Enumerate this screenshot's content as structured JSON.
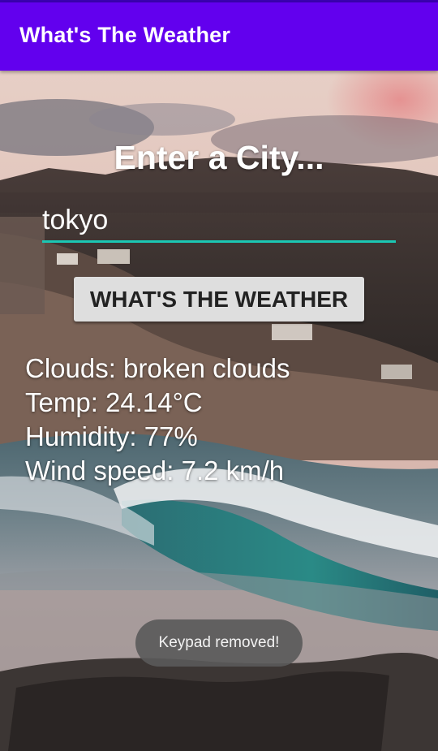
{
  "app_bar": {
    "title": "What's The Weather",
    "color": "#6200ee"
  },
  "main": {
    "heading": "Enter a City...",
    "city_input": {
      "value": "tokyo",
      "underline_color": "#1bc7b4"
    },
    "button_label": "WHAT'S THE WEATHER",
    "results": {
      "clouds": "Clouds: broken clouds",
      "temp": "Temp: 24.14°C",
      "humidity": "Humidity: 77%",
      "wind": "Wind speed: 7.2 km/h"
    }
  },
  "toast": {
    "message": "Keypad removed!"
  },
  "background": {
    "image_icon": "coastal-landscape-photo"
  }
}
